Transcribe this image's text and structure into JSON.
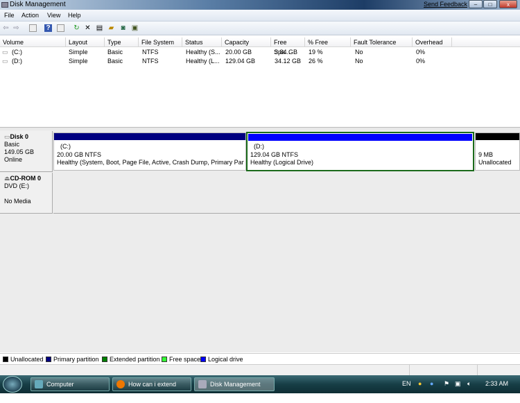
{
  "window": {
    "title": "Disk Management",
    "send_feedback": "Send Feedback",
    "minimize": "–",
    "maximize": "□",
    "close": "x"
  },
  "menu": [
    "File",
    "Action",
    "View",
    "Help"
  ],
  "toolbar": [
    "back-icon",
    "forward-icon",
    "console-tree-icon",
    "help-icon",
    "details-pane-icon",
    "refresh-icon",
    "delete-icon",
    "properties-icon",
    "open-icon",
    "explore-icon",
    "settings-icon"
  ],
  "table": {
    "columns": [
      "Volume",
      "Layout",
      "Type",
      "File System",
      "Status",
      "Capacity",
      "Free Spa...",
      "% Free",
      "Fault Tolerance",
      "Overhead"
    ],
    "rows": [
      [
        "(C:)",
        "Simple",
        "Basic",
        "NTFS",
        "Healthy (S...",
        "20.00 GB",
        "3.84 GB",
        "19 %",
        "No",
        "0%"
      ],
      [
        "(D:)",
        "Simple",
        "Basic",
        "NTFS",
        "Healthy (L...",
        "129.04 GB",
        "34.12 GB",
        "26 %",
        "No",
        "0%"
      ]
    ]
  },
  "disks": [
    {
      "name": "Disk 0",
      "type": "Basic",
      "size": "149.05 GB",
      "state": "Online",
      "partitions": [
        {
          "label": "(C:)",
          "size": "20.00 GB NTFS",
          "status": "Healthy (System, Boot, Page File, Active, Crash Dump, Primary Partiti",
          "color": "#000080"
        },
        {
          "label": "(D:)",
          "size": "129.04 GB NTFS",
          "status": "Healthy (Logical Drive)",
          "color": "#0000ff",
          "selected": true
        },
        {
          "label": "",
          "size": "9 MB",
          "status": "Unallocated",
          "color": "#000000"
        }
      ]
    },
    {
      "name": "CD-ROM 0",
      "type": "DVD (E:)",
      "size": "",
      "state": "No Media"
    }
  ],
  "legend": [
    {
      "label": "Unallocated",
      "color": "#000000"
    },
    {
      "label": "Primary partition",
      "color": "#000080"
    },
    {
      "label": "Extended partition",
      "color": "#008000"
    },
    {
      "label": "Free space",
      "color": "#33ff33"
    },
    {
      "label": "Logical drive",
      "color": "#0000ff"
    }
  ],
  "taskbar": {
    "tasks": [
      "Computer",
      "How can i extend my...",
      "Disk Management"
    ],
    "lang": "EN",
    "clock": "2:33 AM"
  }
}
